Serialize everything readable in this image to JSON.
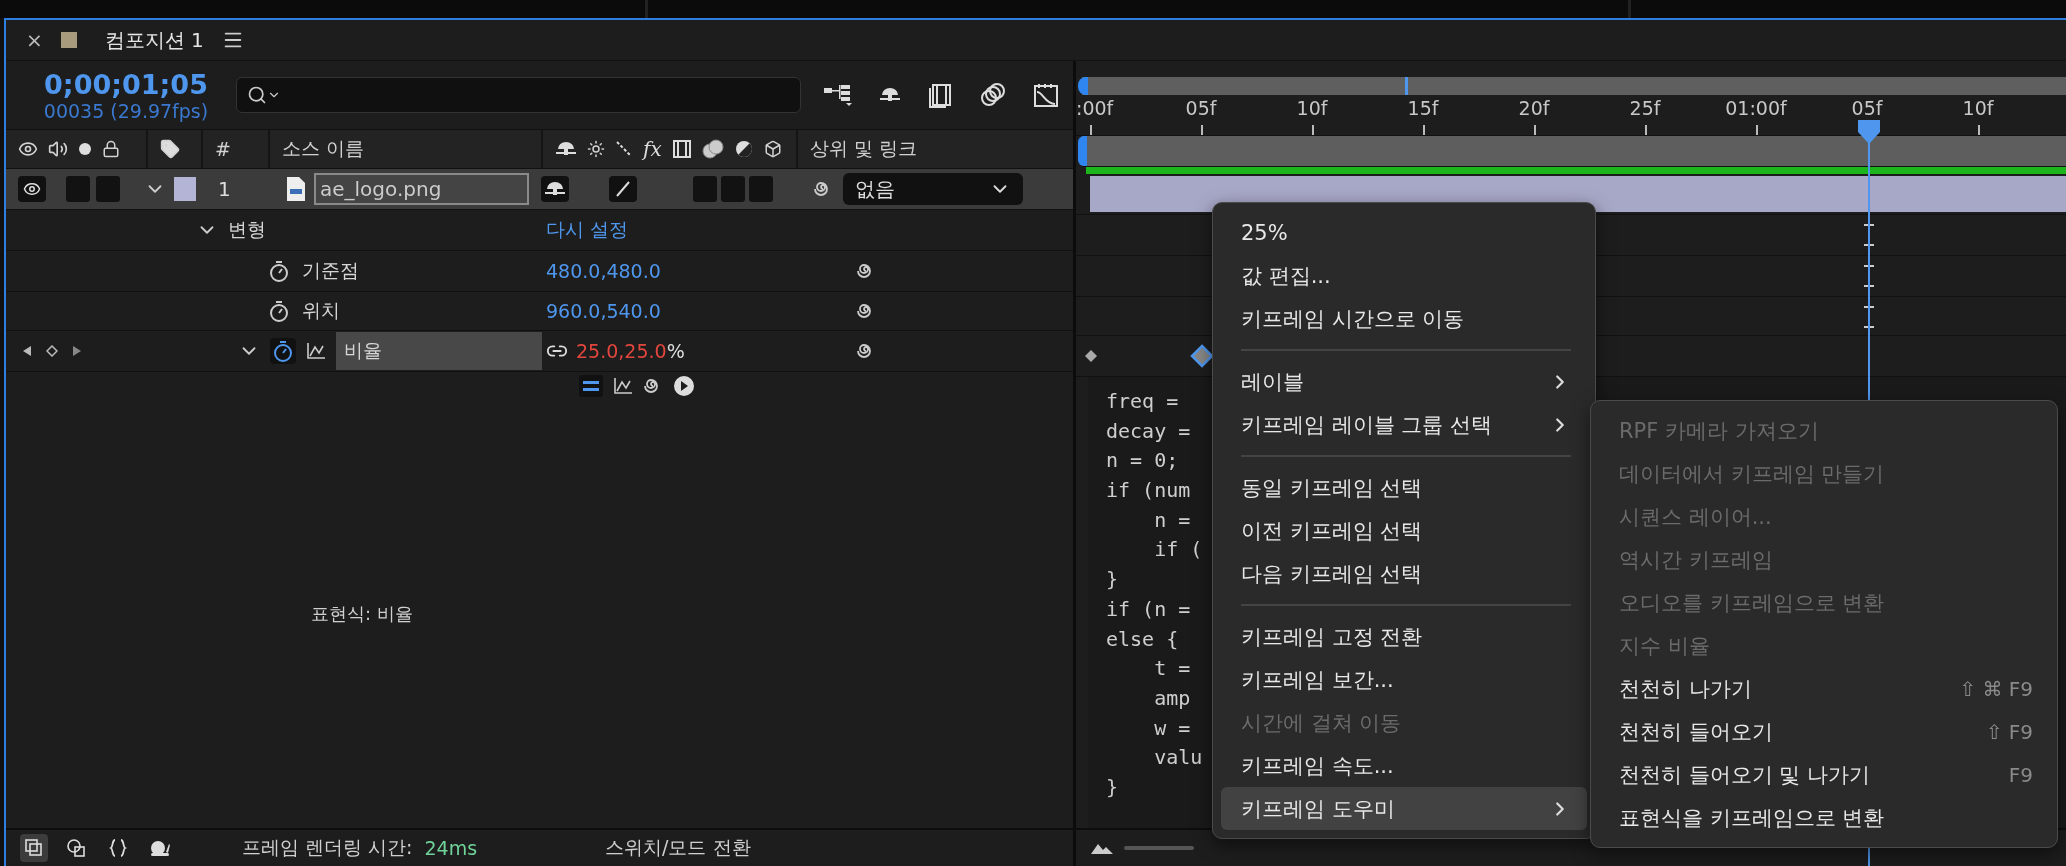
{
  "panel": {
    "close": "×",
    "title": "컴포지션 1"
  },
  "time": {
    "timecode": "0;00;01;05",
    "frames": "00035 (29.97fps)"
  },
  "columns": {
    "number": "#",
    "source": "소스 이름",
    "fx": "fx",
    "parent": "상위 및 링크"
  },
  "layer": {
    "visible": true,
    "selected": true,
    "number": "1",
    "name": "ae_logo.png",
    "parent": "없음"
  },
  "properties": [
    {
      "kind": "group",
      "name": "변형",
      "value": "다시 설정",
      "selected": false
    },
    {
      "kind": "property",
      "name": "기준점",
      "value": "480.0,480.0",
      "selected": false
    },
    {
      "kind": "property",
      "name": "위치",
      "value": "960.0,540.0",
      "selected": false
    },
    {
      "kind": "animated",
      "name": "비율",
      "value": "25.0,25.0",
      "unit": "%",
      "selected": true
    }
  ],
  "expression": {
    "label": "표현식: 비율",
    "code": [
      "freq =",
      "decay =",
      "n = 0;",
      "if (num",
      "    n =",
      "    if (",
      "}",
      "if (n =",
      "else {",
      "    t =",
      "    amp",
      "    w =",
      "    valu",
      "}"
    ]
  },
  "ruler": [
    ":00f",
    "05f",
    "10f",
    "15f",
    "20f",
    "25f",
    "01:00f",
    "05f",
    "10f"
  ],
  "status": {
    "render_label": "프레임 렌더링 시간:",
    "render_time": "24ms",
    "toggle": "스위치/모드 전환"
  },
  "context_menu": {
    "items": [
      {
        "kind": "item",
        "label": "25%",
        "disabled": false,
        "has_submenu": false,
        "highlighted": false
      },
      {
        "kind": "item",
        "label": "값 편집...",
        "disabled": false,
        "has_submenu": false,
        "highlighted": false
      },
      {
        "kind": "item",
        "label": "키프레임 시간으로 이동",
        "disabled": false,
        "has_submenu": false,
        "highlighted": false
      },
      {
        "kind": "separator"
      },
      {
        "kind": "item",
        "label": "레이블",
        "disabled": false,
        "has_submenu": true,
        "highlighted": false
      },
      {
        "kind": "item",
        "label": "키프레임 레이블 그룹 선택",
        "disabled": false,
        "has_submenu": true,
        "highlighted": false
      },
      {
        "kind": "separator"
      },
      {
        "kind": "item",
        "label": "동일 키프레임 선택",
        "disabled": false,
        "has_submenu": false,
        "highlighted": false
      },
      {
        "kind": "item",
        "label": "이전 키프레임 선택",
        "disabled": false,
        "has_submenu": false,
        "highlighted": false
      },
      {
        "kind": "item",
        "label": "다음 키프레임 선택",
        "disabled": false,
        "has_submenu": false,
        "highlighted": false
      },
      {
        "kind": "separator"
      },
      {
        "kind": "item",
        "label": "키프레임 고정 전환",
        "disabled": false,
        "has_submenu": false,
        "highlighted": false
      },
      {
        "kind": "item",
        "label": "키프레임 보간...",
        "disabled": false,
        "has_submenu": false,
        "highlighted": false
      },
      {
        "kind": "item",
        "label": "시간에 걸쳐 이동",
        "disabled": true,
        "has_submenu": false,
        "highlighted": false
      },
      {
        "kind": "item",
        "label": "키프레임 속도...",
        "disabled": false,
        "has_submenu": false,
        "highlighted": false
      },
      {
        "kind": "item",
        "label": "키프레임 도우미",
        "disabled": false,
        "has_submenu": true,
        "highlighted": true
      }
    ]
  },
  "submenu": {
    "items": [
      {
        "label": "RPF 카메라 가져오기",
        "disabled": true
      },
      {
        "label": "데이터에서 키프레임 만들기",
        "disabled": true
      },
      {
        "label": "시퀀스 레이어...",
        "disabled": true
      },
      {
        "label": "역시간 키프레임",
        "disabled": true
      },
      {
        "label": "오디오를 키프레임으로 변환",
        "disabled": true
      },
      {
        "label": "지수 비율",
        "disabled": true
      },
      {
        "label": "천천히 나가기",
        "disabled": false,
        "shortcut": "⇧ ⌘ F9"
      },
      {
        "label": "천천히 들어오기",
        "disabled": false,
        "shortcut": "⇧ F9"
      },
      {
        "label": "천천히 들어오기 및 나가기",
        "disabled": false,
        "shortcut": "F9"
      },
      {
        "label": "표현식을 키프레임으로 변환",
        "disabled": false
      }
    ]
  }
}
